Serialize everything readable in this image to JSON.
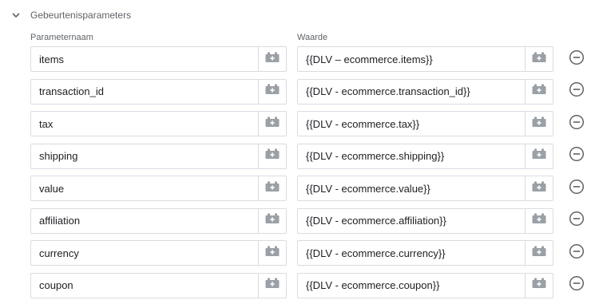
{
  "section": {
    "title": "Gebeurtenisparameters",
    "expanded": true,
    "icon": "chevron-down-icon"
  },
  "columns": {
    "name": "Parameternaam",
    "value": "Waarde"
  },
  "icons": {
    "variable": "variable-picker-icon",
    "remove": "remove-circle-icon"
  },
  "colors": {
    "border": "#dadce0",
    "icon": "#9aa0a6",
    "label": "#5f6368",
    "text": "#202124"
  },
  "rows": [
    {
      "name": "items",
      "value": "{{DLV – ecommerce.items}}"
    },
    {
      "name": "transaction_id",
      "value": "{{DLV - ecommerce.transaction_id}}"
    },
    {
      "name": "tax",
      "value": "{{DLV - ecommerce.tax}}"
    },
    {
      "name": "shipping",
      "value": "{{DLV - ecommerce.shipping}}"
    },
    {
      "name": "value",
      "value": "{{DLV - ecommerce.value}}"
    },
    {
      "name": "affiliation",
      "value": "{{DLV - ecommerce.affiliation}}"
    },
    {
      "name": "currency",
      "value": "{{DLV - ecommerce.currency}}"
    },
    {
      "name": "coupon",
      "value": "{{DLV - ecommerce.coupon}}"
    }
  ]
}
